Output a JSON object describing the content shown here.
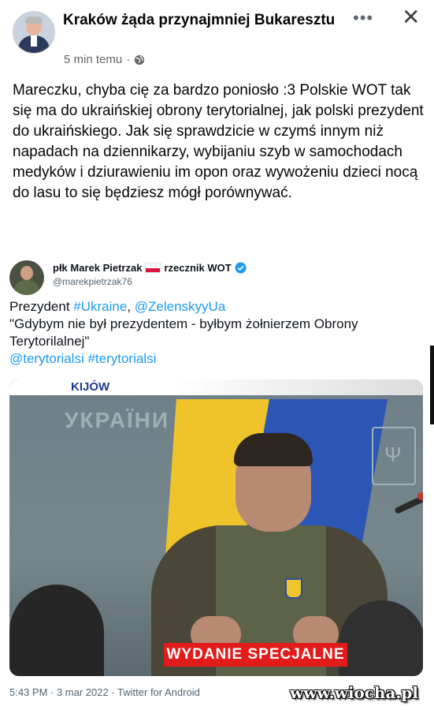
{
  "post": {
    "group_name": "Kraków żąda przynajmniej Bukaresztu",
    "time": "5 min temu",
    "separator": "·",
    "more_icon": "more-dots-icon",
    "close_icon": "close-icon",
    "privacy_icon": "globe-icon",
    "text": "Mareczku, chyba cię za bardzo poniosło :3 Polskie WOT tak się ma do ukraińskiej obrony terytorialnej, jak polski prezydent do ukraińskiego. Jak się sprawdzicie w czymś innym niż napadach na dziennikarzy, wybijaniu szyb w samochodach medyków i dziurawieniu im opon oraz wywożeniu dzieci nocą do lasu to się będziesz mógł porównywać."
  },
  "tweet": {
    "name": "płk Marek Pietrzak",
    "role": "rzecznik WOT",
    "handle": "@marekpietrzak76",
    "line1_prefix": "Prezydent ",
    "line1_tag": "#Ukraine",
    "line1_sep": ", ",
    "line1_mention": "@ZelenskyyUa",
    "quote": "\"Gdybym nie był prezydentem - byłbym żołnierzem Obrony Terytorilalnej\"",
    "tags_line": "@terytorialsi #terytorialsi",
    "footer": "5:43 PM · 3 mar 2022 · Twitter for Android",
    "media": {
      "location_label": "KIJÓW",
      "banner": "WYDANIE SPECJALNE",
      "wall_text": "УКРАЇНИ"
    }
  },
  "watermark": "www.wiocha.pl",
  "colors": {
    "link": "#1d9bf0",
    "banner": "#e21b1b",
    "verified": "#1d9bf0"
  }
}
